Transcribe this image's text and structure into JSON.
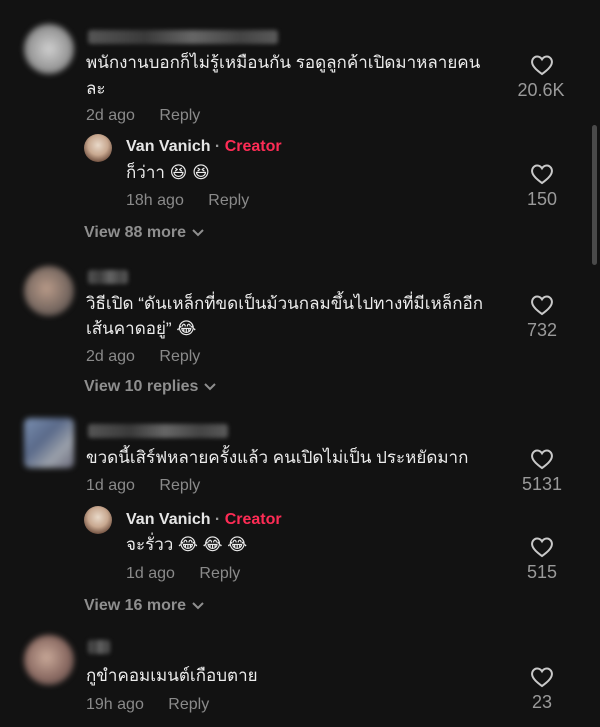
{
  "reply_label": "Reply",
  "colors": {
    "background": "#121212",
    "creator": "#fe2c55",
    "muted": "#8a8a8a"
  },
  "comments": [
    {
      "text1": "พนักงานบอกก็ไม่รู้เหมือนกัน รอดูลูกค้าเปิดมาหลายคน",
      "text2": "ละ",
      "time": "2d ago",
      "likes": "20.6K",
      "reply": {
        "name": "Van Vanich",
        "tag": "Creator",
        "text": "ก็ว่าา 😆 😆",
        "time": "18h ago",
        "likes": "150"
      },
      "view_more": "View 88 more"
    },
    {
      "text1": "วิธีเปิด “ดันเหล็กที่ขดเป็นม้วนกลมขึ้นไปทางที่มีเหล็กอีก",
      "text2": "เส้นคาดอยู่” 😂",
      "time": "2d ago",
      "likes": "732",
      "view_more": "View 10 replies"
    },
    {
      "text1": "ขวดนี้เสิร์ฟหลายครั้งแล้ว คนเปิดไม่เป็น ประหยัดมาก",
      "time": "1d ago",
      "likes": "5131",
      "reply": {
        "name": "Van Vanich",
        "tag": "Creator",
        "text": "จะรั่วว 😂 😂 😂",
        "time": "1d ago",
        "likes": "515"
      },
      "view_more": "View 16 more"
    },
    {
      "text1": "กูขำคอมเมนต์เกือบตาย",
      "time": "19h ago",
      "likes": "23"
    }
  ],
  "icons": {
    "like": "heart-outline-icon",
    "expand": "chevron-down-icon"
  }
}
